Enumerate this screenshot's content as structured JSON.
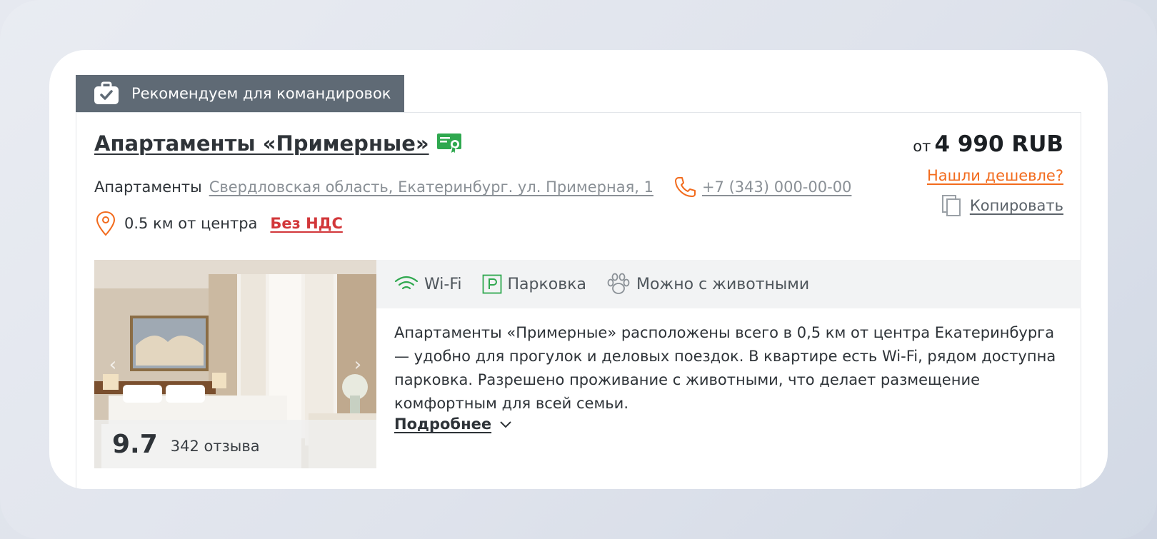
{
  "badge": {
    "label": "Рекомендуем для командировок",
    "icon": "briefcase-check-icon"
  },
  "hotel": {
    "title": "Апартаменты «Примерные»",
    "type": "Апартаменты",
    "address": "Свердловская область, Екатеринбург. ул. Примерная, 1",
    "phone": "+7 (343) 000-00-00",
    "distance": "0.5 км от центра",
    "vat": "Без НДС"
  },
  "price": {
    "prefix": "от",
    "amount": "4 990 RUB"
  },
  "actions": {
    "cheaper": "Нашли дешевле?",
    "copy": "Копировать"
  },
  "rating": {
    "score": "9.7",
    "reviews": "342 отзыва"
  },
  "amenities": [
    {
      "label": "Wi-Fi",
      "icon": "wifi-icon"
    },
    {
      "label": "Парковка",
      "icon": "parking-icon"
    },
    {
      "label": "Можно с животными",
      "icon": "paw-icon"
    }
  ],
  "description": "Апартаменты «Примерные» расположены всего в 0,5 км от центра Екатеринбурга — удобно для прогулок и деловых поездок. В квартире есть Wi-Fi, рядом доступна парковка. Разрешено проживание с животными, что делает размещение комфортным для всей семьи.",
  "more": "Подробнее",
  "colors": {
    "accent_orange": "#f26b1d",
    "vat_red": "#d2373a",
    "badge_bg": "#5f6a75",
    "icon_green": "#2fa84f"
  }
}
